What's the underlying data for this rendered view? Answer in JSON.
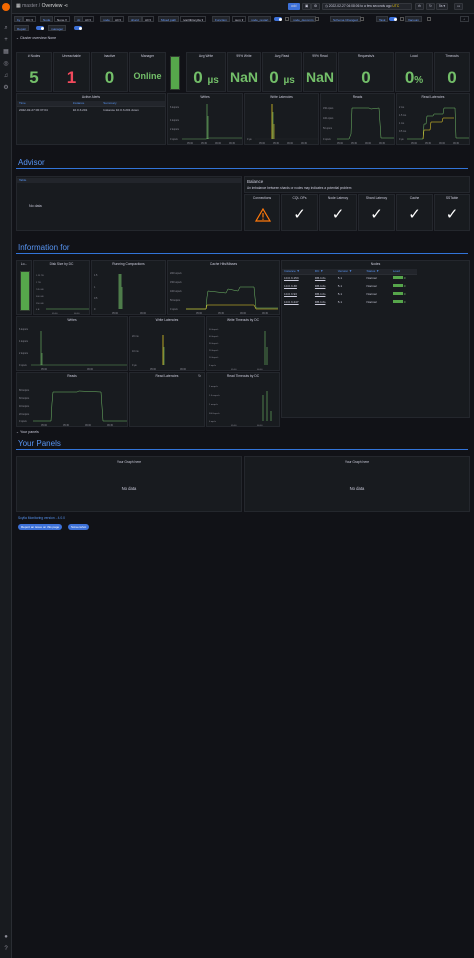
{
  "topbar": {
    "app": "master",
    "sep": "/",
    "page": "Overview",
    "time_range": "2022-02-27 04:08:06 to a few seconds ago",
    "time_range_tz": "UTC",
    "refresh": "5s",
    "zoom_label": "⊖"
  },
  "variables": {
    "row1": [
      {
        "label": "by",
        "value": "DC"
      },
      {
        "label": "Node",
        "value": "None"
      },
      {
        "label": "dc",
        "value": "All"
      },
      {
        "label": "node",
        "value": "All"
      },
      {
        "label": "shard",
        "value": "All"
      },
      {
        "label": "Mixed path",
        "value": "/var/lib/scylla"
      },
      {
        "label": "Function",
        "value": "sum"
      }
    ],
    "row1_toggles": [
      {
        "label": "node_restart",
        "on": true
      },
      {
        "label": "node_decomm",
        "on": false
      },
      {
        "label": "Schema Changed",
        "on": false
      },
      {
        "label": "Task",
        "on": true
      },
      {
        "label": "Vacuum",
        "on": false
      }
    ],
    "row2_toggles": [
      {
        "label": "Repair",
        "on": true
      },
      {
        "label": "manager",
        "on": true
      }
    ]
  },
  "cluster_row": {
    "title": "Cluster overview None"
  },
  "stats": [
    {
      "title": "# Nodes",
      "value": "5",
      "color": "green"
    },
    {
      "title": "Unreachable",
      "value": "1",
      "color": "red"
    },
    {
      "title": "Inactive",
      "value": "0",
      "color": "green"
    },
    {
      "title": "Manager",
      "value": "Online",
      "color": "green"
    },
    {
      "title": "Avg Write",
      "value": "0",
      "unit": "µs",
      "color": "green"
    },
    {
      "title": "99% Write",
      "value": "NaN",
      "color": "green"
    },
    {
      "title": "Avg Read",
      "value": "0",
      "unit": "µs",
      "color": "green"
    },
    {
      "title": "99% Read",
      "value": "NaN",
      "color": "green"
    },
    {
      "title": "Requests/s",
      "value": "0",
      "color": "green"
    },
    {
      "title": "Load",
      "value": "0",
      "unit": "%",
      "color": "green"
    },
    {
      "title": "Timeouts",
      "value": "0",
      "color": "green"
    }
  ],
  "alerts": {
    "title": "Active Alerts",
    "headers": [
      "Time",
      "Instance",
      "Summary"
    ],
    "rows": [
      [
        "2022-02-27 06:37:04",
        "10.0.3.201",
        "Instance 10.0.3.201 down"
      ]
    ]
  },
  "graphs_row1": [
    {
      "title": "Writes",
      "yticks": [
        "6 kops/s",
        "4 kops/s",
        "2 kops/s",
        "0 ops/s"
      ],
      "xticks": [
        "05:00",
        "05:30",
        "06:00",
        "06:30"
      ]
    },
    {
      "title": "Write Latencies",
      "yticks": [
        "",
        "",
        "",
        "0 µs"
      ],
      "xticks": [
        "05:00",
        "05:30",
        "06:00",
        "06:30"
      ]
    },
    {
      "title": "Reads",
      "yticks": [
        "150 ops/s",
        "100 ops/s",
        "50 ops/s",
        "0 ops/s"
      ],
      "xticks": [
        "05:00",
        "05:30",
        "06:00",
        "06:30"
      ]
    },
    {
      "title": "Read Latencies",
      "yticks": [
        "2 ms",
        "1.5 ms",
        "1 ms",
        "0.5 ms",
        "0 µs"
      ],
      "xticks": [
        "05:00",
        "05:30",
        "06:00",
        "06:30"
      ]
    }
  ],
  "advisor": {
    "title": "Advisor",
    "table_header": "Table",
    "no_data": "No data",
    "balance_title": "Balance",
    "balance_text": "An imbalance between shards or nodes may indicates a potential problem",
    "checks": [
      {
        "title": "Connections",
        "kind": "warn"
      },
      {
        "title": "CQL OPs",
        "kind": "ok"
      },
      {
        "title": "Node Latency",
        "kind": "ok"
      },
      {
        "title": "Shard Latency",
        "kind": "ok"
      },
      {
        "title": "Cache",
        "kind": "ok"
      },
      {
        "title": "SSTable",
        "kind": "ok"
      }
    ]
  },
  "info": {
    "title": "Information for",
    "panels": [
      {
        "title": "Lo..."
      },
      {
        "title": "Disk Size by DC",
        "yticks": [
          "1.25 TB",
          "1 TB",
          "745 GB",
          "500 GB",
          "250 GB",
          "0 B"
        ],
        "xticks": [
          "05:00",
          "06:00"
        ]
      },
      {
        "title": "Running Compactions",
        "yticks": [
          "1.5",
          "1",
          "0.5",
          "0"
        ],
        "xticks": [
          "05:00",
          "06:00"
        ]
      },
      {
        "title": "Cache Hits/Misses",
        "yticks": [
          "200 kops/s",
          "150 kops/s",
          "100 kops/s",
          "50 kops/s",
          "0 ops/s"
        ],
        "xticks": [
          "05:00",
          "05:30",
          "06:00",
          "06:30"
        ]
      }
    ],
    "nodes": {
      "title": "Nodes",
      "headers": [
        "Instance",
        "DC",
        "Version",
        "Status",
        "Load"
      ],
      "rows": [
        [
          "10.0.3.153",
          "DB-Info",
          "5.1",
          "Normal",
          "0"
        ],
        [
          "10.0.3.38",
          "DB-Info",
          "5.1",
          "Normal",
          "0"
        ],
        [
          "10.0.3.93",
          "DB-Info",
          "5.1",
          "Normal",
          "0"
        ],
        [
          "10.0.3.247",
          "DB-Info",
          "5.1",
          "Normal",
          "0"
        ]
      ]
    },
    "graphs2": [
      {
        "title": "Writes",
        "yticks": [
          "6 kops/s",
          "4 kops/s",
          "2 kops/s",
          "0 ops/s"
        ],
        "xticks": [
          "05:00",
          "06:00"
        ]
      },
      {
        "title": "Write Latencies",
        "yticks": [
          "20 ms",
          "10 ms",
          "0 µs"
        ],
        "xticks": [
          "05:00",
          "06:00"
        ]
      },
      {
        "title": "Write Timeouts by DC",
        "yticks": [
          "50 kops/s",
          "40 kops/s",
          "30 kops/s",
          "20 kops/s",
          "10 kops/s",
          "0 ops/s"
        ],
        "xticks": [
          "05:00",
          "06:00"
        ]
      }
    ],
    "graphs3": [
      {
        "title": "Reads",
        "yticks": [
          "80 kops/s",
          "60 kops/s",
          "40 kops/s",
          "20 kops/s",
          "0 ops/s"
        ],
        "xticks": [
          "05:00",
          "05:30",
          "06:00",
          "06:30"
        ]
      },
      {
        "title": "Read Latencies"
      },
      {
        "title": "Read Timeouts by DC",
        "yticks": [
          "2 mops/s",
          "1.5 mops/s",
          "1 mops/s",
          "500 kops/s",
          "0 ops/s"
        ],
        "xticks": [
          "05:00",
          "06:00"
        ]
      }
    ]
  },
  "your_panels_row": "Your panels",
  "your_panels": {
    "title": "Your Panels",
    "panels": [
      {
        "title": "Your Graph here",
        "no_data": "No data"
      },
      {
        "title": "Your Graph here",
        "no_data": "No data"
      }
    ]
  },
  "footer": {
    "version": "Scylla Monitoring version - 4.0.0",
    "report_btn": "Report an issue on this page",
    "screenshot_btn": "Screenshot"
  }
}
